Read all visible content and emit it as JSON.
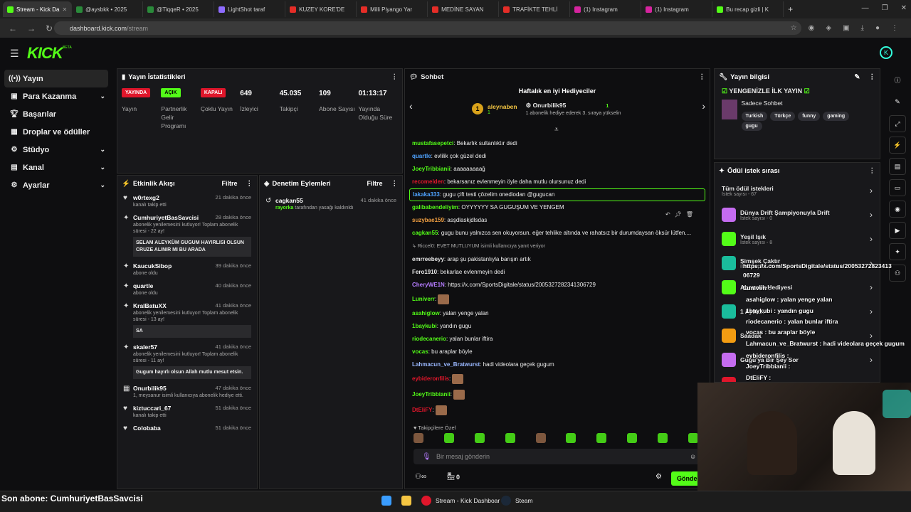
{
  "browser": {
    "tabs": [
      "Stream - Kick Da",
      "@aysbkk • 2025",
      "@TiqqeR • 2025",
      "LightShot taraf",
      "KUZEY KORE'DE",
      "Milli Piyango Yar",
      "MEDİNE SAYAN",
      "TRAFİKTE TEHLİ",
      "(1) Instagram",
      "(1) Instagram",
      "Bu recap gizli | K"
    ],
    "url_host": "dashboard.kick.com",
    "url_path": "/stream"
  },
  "logo": "KICK",
  "logo_beta": "BETA",
  "sidebar": {
    "items": [
      {
        "label": "Yayın"
      },
      {
        "label": "Para Kazanma"
      },
      {
        "label": "Başarılar"
      },
      {
        "label": "Droplar ve ödüller"
      },
      {
        "label": "Stüdyo"
      },
      {
        "label": "Kanal"
      },
      {
        "label": "Ayarlar"
      }
    ]
  },
  "stats": {
    "title": "Yayın İstatistikleri",
    "badges": [
      {
        "value": "YAYINDA",
        "label": "Yayın",
        "color": "#e0162b"
      },
      {
        "value": "AÇIK",
        "label": "Partnerlik Gelir Programı",
        "color": "#53fc18"
      },
      {
        "value": "KAPALI",
        "label": "Çoklu Yayın",
        "color": "#e0162b"
      }
    ],
    "numbers": [
      {
        "value": "649",
        "label": "İzleyici"
      },
      {
        "value": "45.035",
        "label": "Takipçi"
      },
      {
        "value": "109",
        "label": "Abone Sayısı"
      },
      {
        "value": "01:13:17",
        "label": "Yayında Olduğu Süre"
      }
    ]
  },
  "activity": {
    "title": "Etkinlik Akışı",
    "filter": "Filtre",
    "items": [
      {
        "name": "w0rtexg2",
        "time": "21 dakika önce",
        "sub": "kanalı takip etti",
        "msg": ""
      },
      {
        "name": "CumhuriyetBasSavcisi",
        "time": "28 dakika önce",
        "sub": "abonelik yenilemesini kutluyor! Toplam abonelik süresi - 22 ay!",
        "msg": "SELAM ALEYKÜM GUGUM HAYIRLISI OLSUN CRUZE ALINIR MI BU ARADA"
      },
      {
        "name": "KaucukSibop",
        "time": "39 dakika önce",
        "sub": "abone oldu",
        "msg": ""
      },
      {
        "name": "quartle",
        "time": "40 dakika önce",
        "sub": "abone oldu",
        "msg": ""
      },
      {
        "name": "KralBatuXX",
        "time": "41 dakika önce",
        "sub": "abonelik yenilemesini kutluyor! Toplam abonelik süresi - 13 ay!",
        "msg": "SA"
      },
      {
        "name": "skaler57",
        "time": "41 dakika önce",
        "sub": "abonelik yenilemesini kutluyor! Toplam abonelik süresi - 11 ay!",
        "msg": "Gugum hayırlı olsun Allah mutlu mesut etsin."
      },
      {
        "name": "Onurbilik95",
        "time": "47 dakika önce",
        "sub": "1, meysanur isimli kullanıcıya abonelik hediye etti.",
        "msg": ""
      },
      {
        "name": "kiztuccari_67",
        "time": "51 dakika önce",
        "sub": "kanalı takip etti",
        "msg": ""
      },
      {
        "name": "Colobaba",
        "time": "51 dakika önce",
        "sub": "",
        "msg": ""
      }
    ]
  },
  "moderation": {
    "title": "Denetim Eylemleri",
    "filter": "Filtre",
    "item": {
      "name": "cagkan55",
      "time": "41 dakika önce",
      "actor": "rayorka",
      "text": "tarafından yasağı kaldırıldı"
    }
  },
  "chat": {
    "title": "Sohbet",
    "gift_title": "Haftalık en iyi Hediyeciler",
    "top_gifter": {
      "rank": "1",
      "name": "aleynaben",
      "count": "1"
    },
    "second_gifter": {
      "name": "Onurbilik95",
      "count": "1",
      "note": "1 abonelik hediye ederek 3. sıraya yükselin"
    },
    "messages": [
      {
        "user": "mustafasepetci",
        "color": "#53fc18",
        "text": "Bekarlık sultanlıktır dedi"
      },
      {
        "user": "quartle",
        "color": "#4fa3ff",
        "text": "evlilik çok güzel dedi"
      },
      {
        "user": "JoeyTribbianii",
        "color": "#53fc18",
        "text": "aaaaaaaaağ"
      },
      {
        "user": "recomelden",
        "color": "#e0162b",
        "text": "bekarsanız evlenmeyin öyle daha mutlu olursunuz dedi"
      },
      {
        "user": "lakaka333",
        "color": "#4fa3ff",
        "text": "gugu çift testi çözelim onediodan @gugucan",
        "hl": true
      },
      {
        "user": "galibabendeliyim",
        "color": "#53fc18",
        "text": "OYYYYYY SA GUGUŞUM VE YENGEM"
      },
      {
        "user": "suzybae159",
        "color": "#f4a142",
        "text": "asşdlaskjdlsdas"
      },
      {
        "user": "cagkan55",
        "color": "#53fc18",
        "text": "gugu bunu yalnızca sen okuyorsun. eğer tehlike altında ve rahatsız bir durumdaysan öksür lütfen...."
      },
      {
        "user": "",
        "color": "#aaa",
        "text": "↳ Riccel0: EVET MUTLUYUM isimli kullanıcıya yanıt veriyor"
      },
      {
        "user": "emrreebeyy",
        "color": "#e8e8e8",
        "text": "arap şu pakistanlıyla barışın artık"
      },
      {
        "user": "Fero1910",
        "color": "#e8e8e8",
        "text": "bekarlae evlenmeyin dedi"
      },
      {
        "user": "CheryWE1N",
        "color": "#b57cff",
        "text": "https://x.com/SportsDigitale/status/2005327282341306729"
      },
      {
        "user": "Luniverr",
        "color": "#53fc18",
        "text": "",
        "emote": true
      },
      {
        "user": "asahiglow",
        "color": "#53fc18",
        "text": "yalan yenge yalan"
      },
      {
        "user": "1baykubi",
        "color": "#53fc18",
        "text": "yandın gugu"
      },
      {
        "user": "riodecanerio",
        "color": "#53fc18",
        "text": "yalan bunlar iftira"
      },
      {
        "user": "vocas",
        "color": "#53fc18",
        "text": "bu araplar böyle"
      },
      {
        "user": "Lahmacun_ve_Bratwurst",
        "color": "#9ab8ff",
        "text": "hadi videolara geçek gugum"
      },
      {
        "user": "eybideronfilis",
        "color": "#e0162b",
        "text": "",
        "emote": true
      },
      {
        "user": "JoeyTribbianii",
        "color": "#53fc18",
        "text": "",
        "emote": true
      },
      {
        "user": "DtEliFY",
        "color": "#e0162b",
        "text": "",
        "emote": true
      }
    ],
    "followers_only": "Takipçilere Özel",
    "input_placeholder": "Bir mesaj gönderin",
    "count": "0",
    "send": "Gönder"
  },
  "stream_info": {
    "title": "Yayın bilgisi",
    "stream_title": "YENGENİZLE İLK YAYIN",
    "category": "Sadece Sohbet",
    "tags": [
      "Turkish",
      "Türkçe",
      "funny",
      "gaming",
      "gugu"
    ]
  },
  "rewards": {
    "title": "Ödül istek sırası",
    "items": [
      {
        "title": "Tüm ödül istekleri",
        "sub": "İstek sayısı - 67",
        "color": "#0e0e10"
      },
      {
        "title": "Dünya Drift Şampiyonuyla Drift",
        "sub": "İstek sayısı - 0",
        "color": "#c56cf0"
      },
      {
        "title": "Yeşil Işık",
        "sub": "İstek sayısı - 8",
        "color": "#53fc18"
      },
      {
        "title": "Şimşek Çaktır",
        "sub": "İstek sayısı - 2",
        "color": "#1abc9c"
      },
      {
        "title": "Abonelik Hediyesi",
        "sub": "",
        "color": "#53fc18"
      },
      {
        "title": "1 Aylık...",
        "sub": "",
        "color": "#1abc9c"
      },
      {
        "title": "Saadak",
        "sub": "",
        "color": "#f39c12"
      },
      {
        "title": "Gugu'ya Bir Şey Sor",
        "sub": "",
        "color": "#c56cf0"
      },
      {
        "title": "30Dk Ban",
        "sub": "",
        "color": "#e0162b"
      }
    ]
  },
  "overlay_chat": [
    "https://x.com/SportsDigitale/status/20053272823413",
    "06729",
    "Luniverr :",
    "asahiglow : yalan yenge yalan",
    "1baykubi : yandın gugu",
    "riodecanerio : yalan bunlar iftira",
    "vocas : bu araplar böyle",
    "Lahmacun_ve_Bratwurst : hadi videolara geçek gugum",
    "eybideronfilis :",
    "JoeyTribbianii :",
    "DtEliFY :"
  ],
  "taskbar": {
    "last_sub": "Son abone: CumhuriyetBasSavcisi",
    "apps": [
      "Stream - Kick Dashboar",
      "Steam"
    ]
  },
  "colors": {
    "brand": "#53fc18",
    "live": "#e0162b"
  }
}
